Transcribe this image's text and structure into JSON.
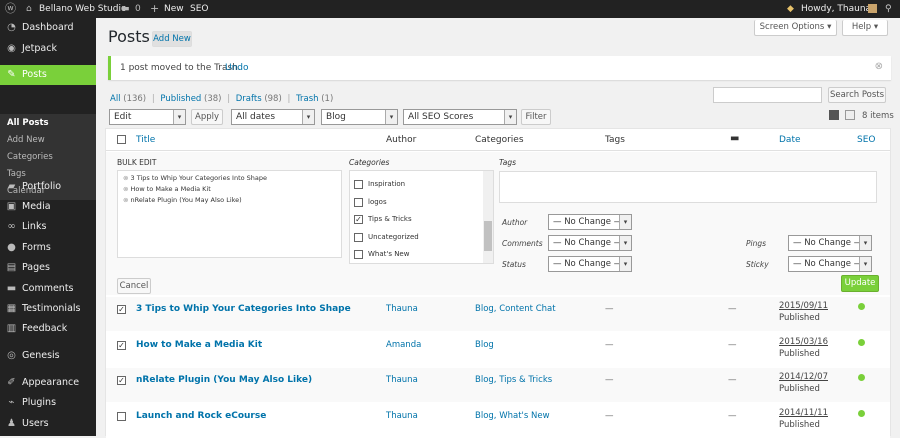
{
  "adminbar": {
    "site_name": "Bellano Web Studio",
    "comments_count": "0",
    "new_label": "New",
    "seo_label": "SEO",
    "howdy": "Howdy, Thauna"
  },
  "sidebar": {
    "items": [
      {
        "label": "Dashboard",
        "icon": "dashboard-icon",
        "glyph": "◔"
      },
      {
        "label": "Jetpack",
        "icon": "jetpack-icon",
        "glyph": "◉"
      },
      {
        "label": "Posts",
        "icon": "pin-icon",
        "glyph": "✎"
      },
      {
        "label": "Portfolio",
        "icon": "portfolio-icon",
        "glyph": "▰"
      },
      {
        "label": "Media",
        "icon": "media-icon",
        "glyph": "▣"
      },
      {
        "label": "Links",
        "icon": "links-icon",
        "glyph": "∞"
      },
      {
        "label": "Forms",
        "icon": "forms-icon",
        "glyph": "●"
      },
      {
        "label": "Pages",
        "icon": "pages-icon",
        "glyph": "▤"
      },
      {
        "label": "Comments",
        "icon": "comments-icon",
        "glyph": "▬"
      },
      {
        "label": "Testimonials",
        "icon": "testimonials-icon",
        "glyph": "▦"
      },
      {
        "label": "Feedback",
        "icon": "feedback-icon",
        "glyph": "▥"
      },
      {
        "label": "Genesis",
        "icon": "genesis-icon",
        "glyph": "◎"
      },
      {
        "label": "Appearance",
        "icon": "appearance-icon",
        "glyph": "✐"
      },
      {
        "label": "Plugins",
        "icon": "plugins-icon",
        "glyph": "⌁"
      },
      {
        "label": "Users",
        "icon": "users-icon",
        "glyph": "♟"
      }
    ],
    "submenu": [
      "All Posts",
      "Add New",
      "Categories",
      "Tags",
      "Calendar"
    ]
  },
  "header": {
    "title": "Posts",
    "add_new": "Add New",
    "screen_options": "Screen Options ▾",
    "help": "Help ▾"
  },
  "notice": {
    "text": "1 post moved to the Trash.",
    "undo": "Undo"
  },
  "filters": {
    "all": "All",
    "all_count": "(136)",
    "published": "Published",
    "published_count": "(38)",
    "drafts": "Drafts",
    "drafts_count": "(98)",
    "trash": "Trash",
    "trash_count": "(1)",
    "sep": "|"
  },
  "search": {
    "value": "",
    "button": "Search Posts"
  },
  "tablenav": {
    "bulk_action": "Edit",
    "apply": "Apply",
    "dates": "All dates",
    "category": "Blog",
    "seo_scores": "All SEO Scores",
    "filter": "Filter",
    "items": "8 items"
  },
  "columns": {
    "title": "Title",
    "author": "Author",
    "categories": "Categories",
    "tags": "Tags",
    "date": "Date",
    "seo": "SEO"
  },
  "bulk_edit": {
    "heading": "BULK EDIT",
    "posts": [
      "3 Tips to Whip Your Categories Into Shape",
      "How to Make a Media Kit",
      "nRelate Plugin (You May Also Like)"
    ],
    "categories_label": "Categories",
    "categories": [
      {
        "label": "Inspiration",
        "checked": ""
      },
      {
        "label": "logos",
        "checked": ""
      },
      {
        "label": "Tips & Tricks",
        "checked": "✓"
      },
      {
        "label": "Uncategorized",
        "checked": ""
      },
      {
        "label": "What's New",
        "checked": ""
      }
    ],
    "tags_label": "Tags",
    "author_label": "Author",
    "author_value": "— No Change —",
    "comments_label": "Comments",
    "comments_value": "— No Change —",
    "status_label": "Status",
    "status_value": "— No Change —",
    "pings_label": "Pings",
    "pings_value": "— No Change —",
    "sticky_label": "Sticky",
    "sticky_value": "— No Change —",
    "cancel": "Cancel",
    "update": "Update"
  },
  "rows": [
    {
      "checked": "✓",
      "title": "3 Tips to Whip Your Categories Into Shape",
      "author": "Thauna",
      "categories": "Blog, Content Chat",
      "tags": "—",
      "comments": "—",
      "date": "2015/09/11",
      "status": "Published"
    },
    {
      "checked": "✓",
      "title": "How to Make a Media Kit",
      "author": "Amanda",
      "categories": "Blog",
      "tags": "—",
      "comments": "—",
      "date": "2015/03/16",
      "status": "Published"
    },
    {
      "checked": "✓",
      "title": "nRelate Plugin (You May Also Like)",
      "author": "Thauna",
      "categories": "Blog, Tips & Tricks",
      "tags": "—",
      "comments": "—",
      "date": "2014/12/07",
      "status": "Published"
    },
    {
      "checked": "",
      "title": "Launch and Rock eCourse",
      "author": "Thauna",
      "categories": "Blog, What's New",
      "tags": "—",
      "comments": "—",
      "date": "2014/11/11",
      "status": "Published"
    }
  ],
  "colors": {
    "adminbar": "#222222",
    "menu_active": "#7ad03a",
    "link": "#0073aa",
    "seo_good": "#7ad03a"
  }
}
